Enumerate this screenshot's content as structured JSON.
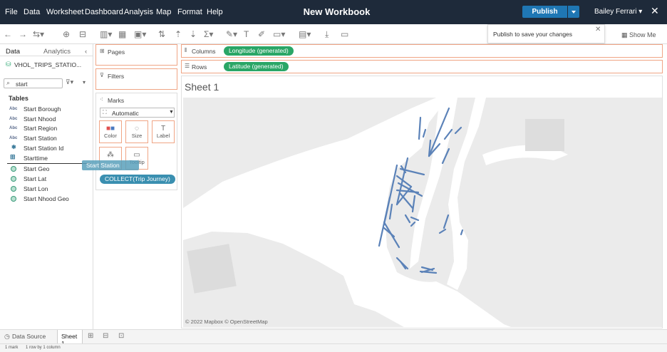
{
  "menu": [
    "File",
    "Data",
    "Worksheet",
    "Dashboard",
    "Analysis",
    "Map",
    "Format",
    "Help"
  ],
  "workbook_title": "New Workbook",
  "publish_label": "Publish",
  "user_name": "Bailey Ferrari ▾",
  "publish_tooltip": "Publish to save your changes",
  "show_me_label": "Show Me",
  "data_pane": {
    "tabs": [
      "Data",
      "Analytics"
    ],
    "datasource": "VHOL_TRIPS_STATIO...",
    "search_value": "start",
    "tables_label": "Tables",
    "fields": [
      {
        "type": "Abc",
        "name": "Start Borough"
      },
      {
        "type": "Abc",
        "name": "Start Nhood"
      },
      {
        "type": "Abc",
        "name": "Start Region"
      },
      {
        "type": "Abc",
        "name": "Start Station"
      },
      {
        "type": "#",
        "name": "Start Station Id"
      },
      {
        "type": "time",
        "name": "Starttime"
      },
      {
        "type": "geo",
        "name": "Start Geo"
      },
      {
        "type": "geo",
        "name": "Start Lat"
      },
      {
        "type": "geo",
        "name": "Start Lon"
      },
      {
        "type": "geo",
        "name": "Start Nhood Geo"
      }
    ],
    "drag_ghost": "Start Station"
  },
  "cards": {
    "pages": "Pages",
    "filters": "Filters",
    "marks": "Marks",
    "mark_type": "Automatic",
    "mark_buttons": [
      "Color",
      "Size",
      "Label",
      "Detail",
      "Tooltip"
    ],
    "mark_pill": "COLLECT(Trip Journey)"
  },
  "shelves": {
    "columns_label": "Columns",
    "columns_pill": "Longitude (generated)",
    "rows_label": "Rows",
    "rows_pill": "Latitude (generated)"
  },
  "sheet_title": "Sheet 1",
  "map_attribution": "© 2022 Mapbox  © OpenStreetMap",
  "bottom_tabs": {
    "data_source": "Data Source",
    "sheet": "Sheet 1"
  },
  "status": {
    "marks": "1 mark",
    "rows": "1 row by 1 column"
  },
  "colors": {
    "topbar": "#1e2a3a",
    "publish": "#1f77b4",
    "pill": "#2aa666",
    "path": "#5b82b8",
    "mark_pill": "#3a8fb0"
  }
}
